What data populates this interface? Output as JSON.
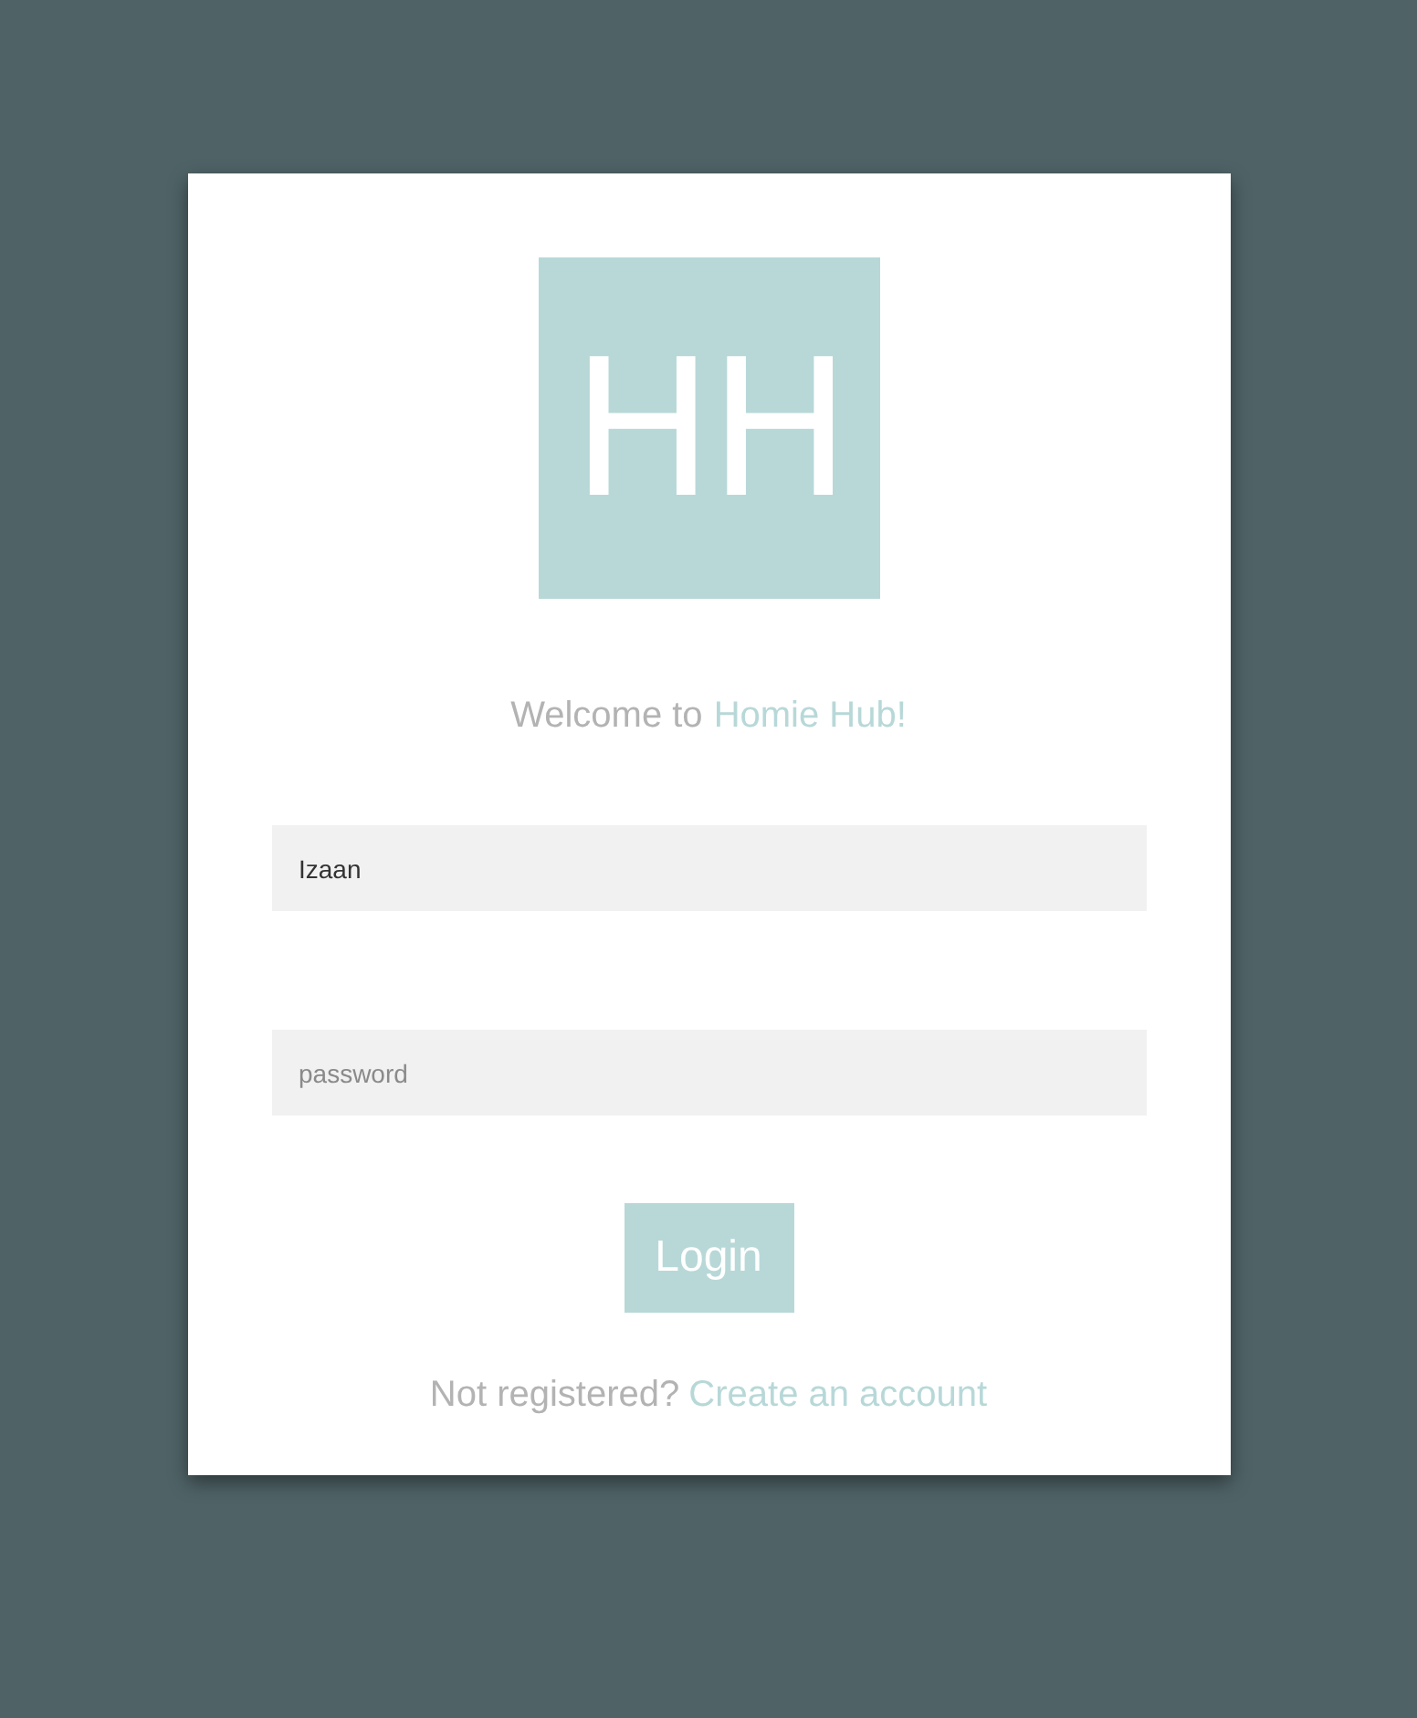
{
  "logo": {
    "text": "HH"
  },
  "welcome": {
    "text": "Welcome to",
    "brand": "Homie Hub!"
  },
  "fields": [
    {
      "kind": "text",
      "value": "Izaan"
    },
    {
      "kind": "password",
      "placeholder": "password"
    }
  ],
  "login_button": {
    "label": "Login"
  },
  "footer": {
    "text": "Not registered?",
    "link": "Create an account"
  }
}
